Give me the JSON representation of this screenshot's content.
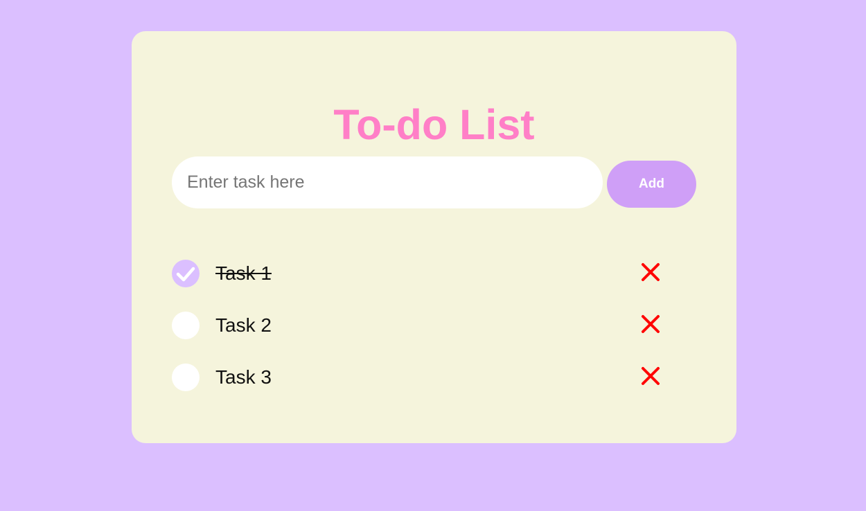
{
  "app": {
    "title": "To-do List"
  },
  "input": {
    "placeholder": "Enter task here",
    "value": ""
  },
  "add_button": {
    "label": "Add"
  },
  "tasks": [
    {
      "label": "Task 1",
      "completed": true
    },
    {
      "label": "Task 2",
      "completed": false
    },
    {
      "label": "Task 3",
      "completed": false
    }
  ],
  "icons": {
    "check": "checkmark-icon",
    "delete": "close-x-icon"
  },
  "colors": {
    "background": "#dbbfff",
    "card": "#f5f4dc",
    "title": "#ff7fc7",
    "button": "#cf9ff7",
    "delete": "#ff0000"
  }
}
